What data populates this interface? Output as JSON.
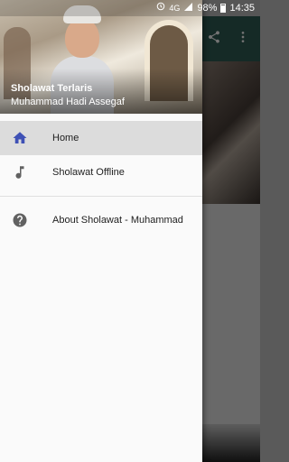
{
  "status_bar": {
    "battery": "98%",
    "time": "14:35",
    "network": "4G"
  },
  "drawer": {
    "header": {
      "title": "Sholawat Terlaris",
      "subtitle": "Muhammad Hadi Assegaf"
    },
    "items": [
      {
        "label": "Home",
        "icon": "home-icon",
        "selected": true
      },
      {
        "label": "Sholawat Offline",
        "icon": "music-note-icon",
        "selected": false
      }
    ],
    "secondary_items": [
      {
        "label": "About Sholawat - Muhammad",
        "icon": "help-icon"
      }
    ]
  },
  "colors": {
    "accent": "#3f51b5",
    "icon_gray": "#616161",
    "selected_bg": "#dcdcdc"
  }
}
